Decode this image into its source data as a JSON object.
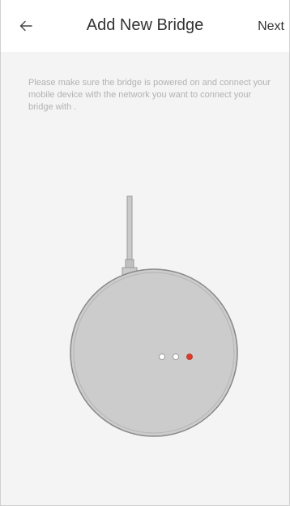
{
  "header": {
    "title": "Add New Bridge",
    "back_icon": "back-arrow-icon",
    "next_label": "Next"
  },
  "instructions": {
    "text": "Please make sure the bridge is powered on and connect your mobile device with the network you want to connect your bridge with ."
  },
  "device": {
    "name": "bridge-device",
    "indicator_lights": [
      "white",
      "white",
      "red"
    ]
  },
  "colors": {
    "background": "#f4f4f4",
    "header_background": "#ffffff",
    "instruction_text": "#b2b2b2",
    "device_body": "#cccccc",
    "indicator_active": "#e03a2a"
  }
}
